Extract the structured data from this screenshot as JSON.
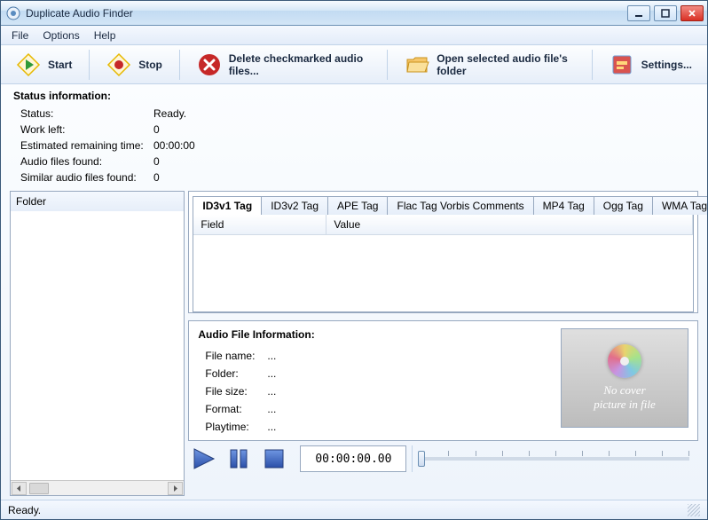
{
  "window": {
    "title": "Duplicate Audio Finder"
  },
  "menu": {
    "file": "File",
    "options": "Options",
    "help": "Help"
  },
  "toolbar": {
    "start": "Start",
    "stop": "Stop",
    "delete": "Delete checkmarked audio files...",
    "openFolder": "Open selected audio file's folder",
    "settings": "Settings..."
  },
  "statusInfo": {
    "heading": "Status information:",
    "statusLabel": "Status:",
    "statusValue": "Ready.",
    "workLabel": "Work left:",
    "workValue": "0",
    "etaLabel": "Estimated remaining time:",
    "etaValue": "00:00:00",
    "foundLabel": "Audio files found:",
    "foundValue": "0",
    "similarLabel": "Similar audio files found:",
    "similarValue": "0"
  },
  "folderPane": {
    "header": "Folder"
  },
  "tabs": {
    "id3v1": "ID3v1 Tag",
    "id3v2": "ID3v2 Tag",
    "ape": "APE Tag",
    "flac": "Flac Tag Vorbis Comments",
    "mp4": "MP4 Tag",
    "ogg": "Ogg Tag",
    "wma": "WMA Tag",
    "colField": "Field",
    "colValue": "Value"
  },
  "audioFileInfo": {
    "heading": "Audio File Information:",
    "fileNameLabel": "File name:",
    "fileNameValue": "...",
    "folderLabel": "Folder:",
    "folderValue": "...",
    "fileSizeLabel": "File size:",
    "fileSizeValue": "...",
    "formatLabel": "Format:",
    "formatValue": "...",
    "playtimeLabel": "Playtime:",
    "playtimeValue": "...",
    "noCover1": "No cover",
    "noCover2": "picture in file"
  },
  "player": {
    "time": "00:00:00.00"
  },
  "statusbar": {
    "text": "Ready."
  }
}
